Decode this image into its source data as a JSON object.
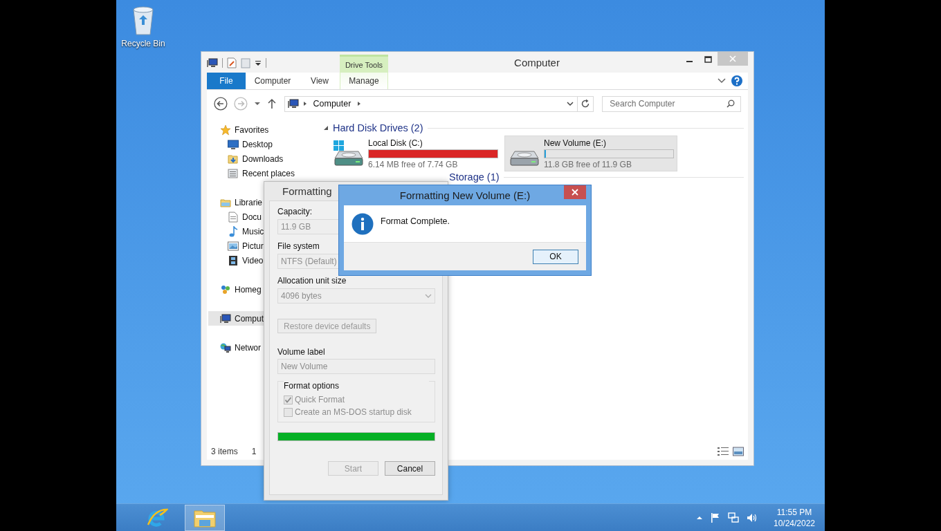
{
  "desktop_icons": [
    {
      "label": "Recycle Bin"
    }
  ],
  "explorer": {
    "title": "Computer",
    "contextual_group": "Drive Tools",
    "ribbon_tabs": [
      {
        "label": "File",
        "kind": "file",
        "selected": false
      },
      {
        "label": "Computer",
        "kind": "tab",
        "selected": false
      },
      {
        "label": "View",
        "kind": "tab",
        "selected": false
      },
      {
        "label": "Manage",
        "kind": "contextual",
        "selected": false
      }
    ],
    "breadcrumb": [
      "Computer"
    ],
    "search": {
      "placeholder": "Search Computer"
    },
    "nav": [
      {
        "label": "Favorites",
        "kind": "star",
        "selected": false,
        "children": [
          {
            "label": "Desktop",
            "kind": "desktop",
            "selected": false
          },
          {
            "label": "Downloads",
            "kind": "downloads",
            "selected": false
          },
          {
            "label": "Recent places",
            "kind": "recent",
            "selected": false
          }
        ]
      },
      {
        "label": "Librarie",
        "kind": "libraries",
        "selected": false,
        "children": [
          {
            "label": "Docu",
            "kind": "document",
            "selected": false
          },
          {
            "label": "Music",
            "kind": "music",
            "selected": false
          },
          {
            "label": "Pictur",
            "kind": "pictures",
            "selected": false
          },
          {
            "label": "Video",
            "kind": "videos",
            "selected": false
          }
        ]
      },
      {
        "label": "Homeg",
        "kind": "homegroup",
        "selected": false
      },
      {
        "label": "Comput",
        "kind": "computer",
        "selected": true
      },
      {
        "label": "Networ",
        "kind": "network",
        "selected": false
      }
    ],
    "groups": [
      {
        "title": "Hard Disk Drives (2)",
        "expanded": true,
        "drives": [
          {
            "name": "Local Disk (C:)",
            "kind": "system",
            "free": "6.14 MB free of 7.74 GB",
            "level": 0.999,
            "selected": false
          },
          {
            "name": "New Volume (E:)",
            "kind": "disk",
            "free": "11.8 GB free of 11.9 GB",
            "level": 0.01,
            "selected": true
          }
        ]
      },
      {
        "title": "Storage (1)"
      }
    ],
    "status": {
      "count": "3 items",
      "selection": "1"
    }
  },
  "format_dialog": {
    "title": "Formatting",
    "fields": [
      {
        "label": "Capacity:",
        "value": "11.9 GB",
        "kind": "box",
        "disabled": true
      },
      {
        "label": "File system",
        "value": "NTFS (Default)",
        "kind": "box",
        "disabled": true
      },
      {
        "label": "Allocation unit size",
        "value": "4096 bytes",
        "kind": "select",
        "disabled": true
      }
    ],
    "restore_button": {
      "label": "Restore device defaults",
      "disabled": true
    },
    "volume_label": {
      "label": "Volume label",
      "value": "New Volume",
      "disabled": true
    },
    "options_title": "Format options",
    "options": [
      {
        "label": "Quick Format",
        "checked": true,
        "disabled": true
      },
      {
        "label": "Create an MS-DOS startup disk",
        "checked": false,
        "disabled": true
      }
    ],
    "progress": {
      "level": 1
    },
    "buttons": [
      {
        "label": "Start",
        "disabled": true
      },
      {
        "label": "Cancel",
        "disabled": false
      }
    ]
  },
  "message_box": {
    "title": "Formatting New Volume (E:)",
    "message": "Format Complete.",
    "button": "OK"
  },
  "taskbar": {
    "apps": [
      {
        "kind": "browser",
        "selected": false
      },
      {
        "kind": "explorer",
        "selected": true
      }
    ],
    "time": "11:55 PM",
    "date": "10/24/2022"
  }
}
